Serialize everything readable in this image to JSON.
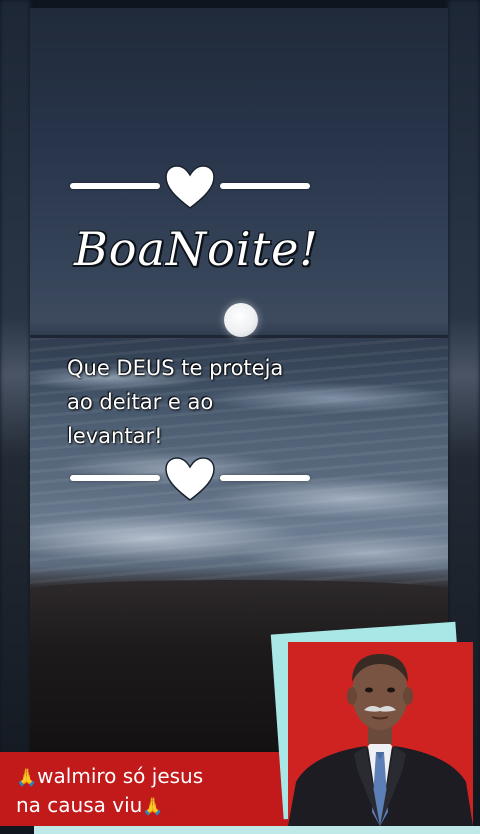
{
  "greeting": "BoaNoite!",
  "message": {
    "line1": "Que DEUS te proteja",
    "line2": "ao deitar e ao",
    "line3": "levantar!"
  },
  "caption": {
    "line1": "walmiro só jesus",
    "line2": "na causa viu",
    "pray_emoji": "🙏"
  },
  "icons": {
    "divider": "heart-icon",
    "caption": "pray-icon"
  },
  "colors": {
    "caption_bg": "#c2191b",
    "camera_bg": "#cf2322",
    "accent_back": "#a8e7e5"
  }
}
